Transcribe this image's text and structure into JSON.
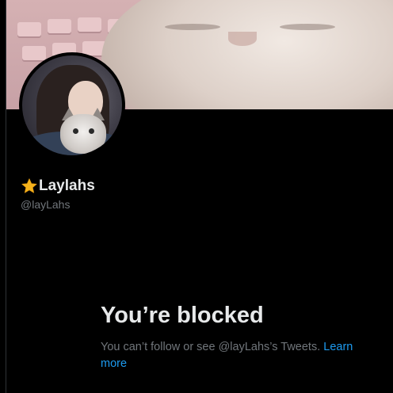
{
  "profile": {
    "display_name": "Laylahs",
    "handle": "@layLahs",
    "name_badge_icon": "star-icon"
  },
  "blocked": {
    "title": "You’re blocked",
    "message": "You can’t follow or see @layLahs’s Tweets.",
    "learn_more": "Learn more"
  },
  "colors": {
    "background": "#000000",
    "primary_text": "#e7e9ea",
    "secondary_text": "#71767b",
    "link": "#1d9bf0",
    "star": "#f5b31c"
  }
}
